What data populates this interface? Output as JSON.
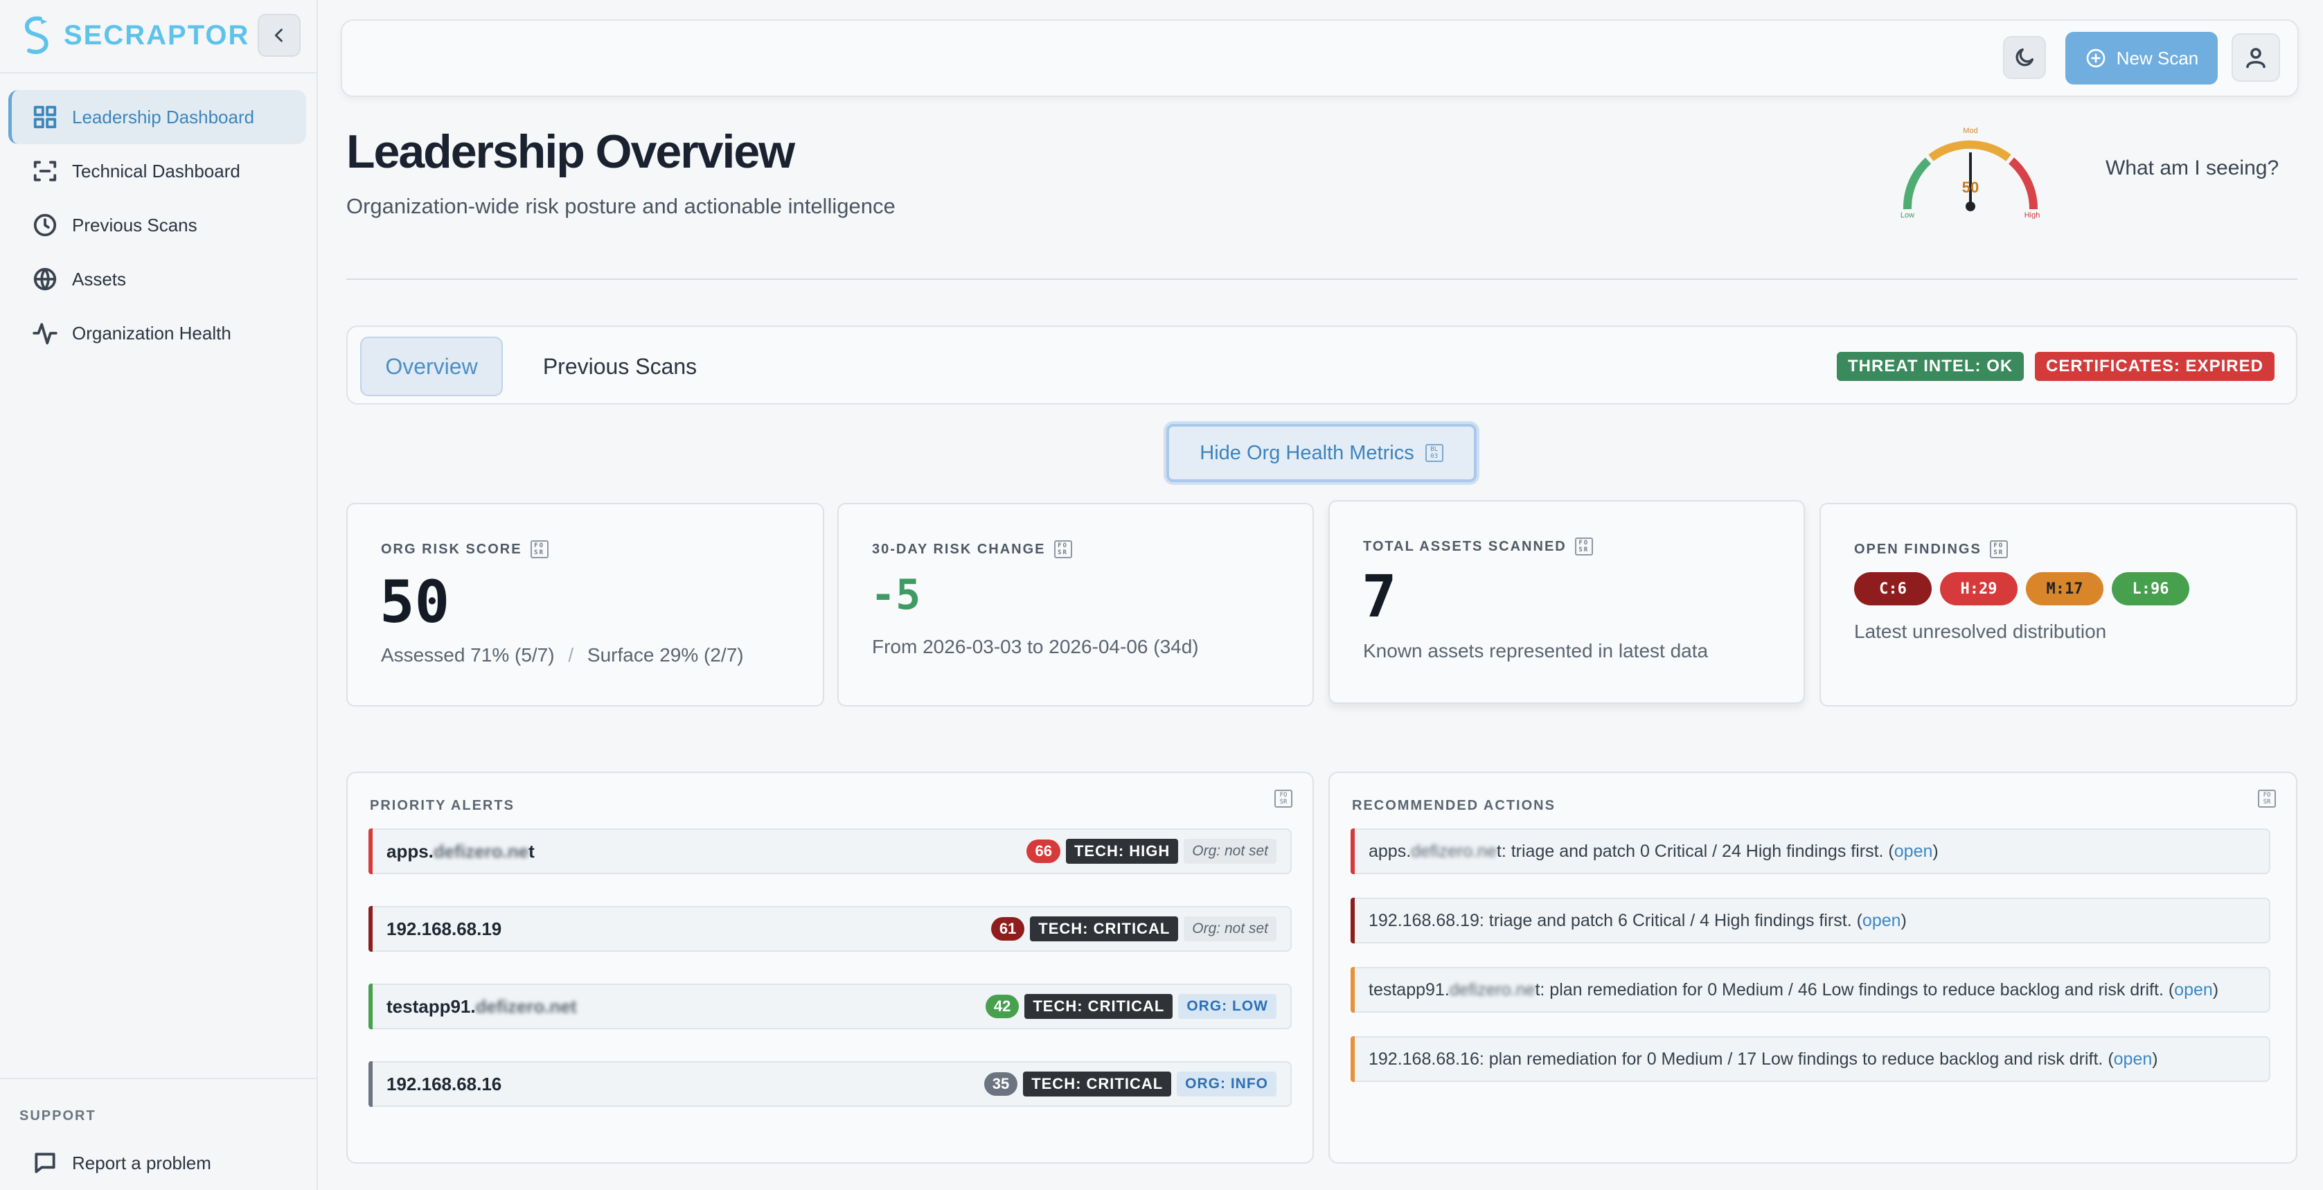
{
  "brand": {
    "name": "SECRAPTOR",
    "color": "#5ec3ea"
  },
  "sidebar": {
    "items": [
      {
        "label": "Leadership Dashboard",
        "icon": "grid-icon",
        "active": true
      },
      {
        "label": "Technical Dashboard",
        "icon": "scan-frame-icon"
      },
      {
        "label": "Previous Scans",
        "icon": "clock-icon"
      },
      {
        "label": "Assets",
        "icon": "globe-icon"
      },
      {
        "label": "Organization Health",
        "icon": "activity-icon"
      }
    ],
    "support_label": "SUPPORT",
    "report_label": "Report a problem"
  },
  "topbar": {
    "new_scan_label": "New Scan"
  },
  "header": {
    "title": "Leadership Overview",
    "subtitle": "Organization-wide risk posture and actionable intelligence",
    "what_label": "What am I seeing?",
    "gauge": {
      "value": "50",
      "level": 50,
      "low": "Low",
      "mod": "Mod",
      "high": "High"
    }
  },
  "tabs": {
    "overview": "Overview",
    "previous": "Previous Scans"
  },
  "status": {
    "threat_intel": "THREAT INTEL: OK",
    "certificates": "CERTIFICATES: EXPIRED"
  },
  "hide_button": {
    "label": "Hide Org Health Metrics"
  },
  "metrics": {
    "risk_score": {
      "label": "ORG RISK SCORE",
      "value": "50",
      "assessed": "Assessed 71% (5/7)",
      "sep": "/",
      "surface": "Surface 29% (2/7)"
    },
    "risk_change": {
      "label": "30-DAY RISK CHANGE",
      "value": "-5",
      "sub": "From 2026-03-03 to 2026-04-06 (34d)"
    },
    "assets": {
      "label": "TOTAL ASSETS SCANNED",
      "value": "7",
      "sub": "Known assets represented in latest data"
    },
    "findings": {
      "label": "OPEN FINDINGS",
      "critical": "C:6",
      "high": "H:29",
      "medium": "M:17",
      "low": "L:96",
      "sub": "Latest unresolved distribution"
    }
  },
  "alerts": {
    "title": "PRIORITY ALERTS",
    "rows": [
      {
        "host_prefix": "apps.",
        "host_blur": "defizero.ne",
        "host_suffix": "t",
        "score": "66",
        "tech": "TECH: HIGH",
        "org": "Org: not set"
      },
      {
        "host_prefix": "192.168.68.19",
        "host_blur": "",
        "host_suffix": "",
        "score": "61",
        "tech": "TECH: CRITICAL",
        "org": "Org: not set"
      },
      {
        "host_prefix": "testapp91.",
        "host_blur": "defizero.net",
        "host_suffix": "",
        "score": "42",
        "tech": "TECH: CRITICAL",
        "org": "ORG: LOW"
      },
      {
        "host_prefix": "192.168.68.16",
        "host_blur": "",
        "host_suffix": "",
        "score": "35",
        "tech": "TECH: CRITICAL",
        "org": "ORG: INFO"
      }
    ]
  },
  "actions": {
    "title": "RECOMMENDED ACTIONS",
    "open_label": "open",
    "rows": [
      {
        "prefix": "apps.",
        "blur": "defizero.ne",
        "text": "t: triage and patch 0 Critical / 24 High findings first. ("
      },
      {
        "prefix": "192.168.68.19",
        "blur": "",
        "text": ": triage and patch 6 Critical / 4 High findings first. ("
      },
      {
        "prefix": "testapp91.",
        "blur": "defizero.ne",
        "text": "t: plan remediation for 0 Medium / 46 Low findings to reduce backlog and risk drift. ("
      },
      {
        "prefix": "192.168.68.16",
        "blur": "",
        "text": ": plan remediation for 0 Medium / 17 Low findings to reduce backlog and risk drift. ("
      }
    ]
  },
  "colors": {
    "accent": "#70aee0",
    "ok": "#3a8a5e",
    "expired": "#d33b3b",
    "critical": "#8f1d1d",
    "high": "#d63a3a",
    "medium": "#d9862b",
    "low": "#46a04e",
    "info": "#6b7480"
  }
}
